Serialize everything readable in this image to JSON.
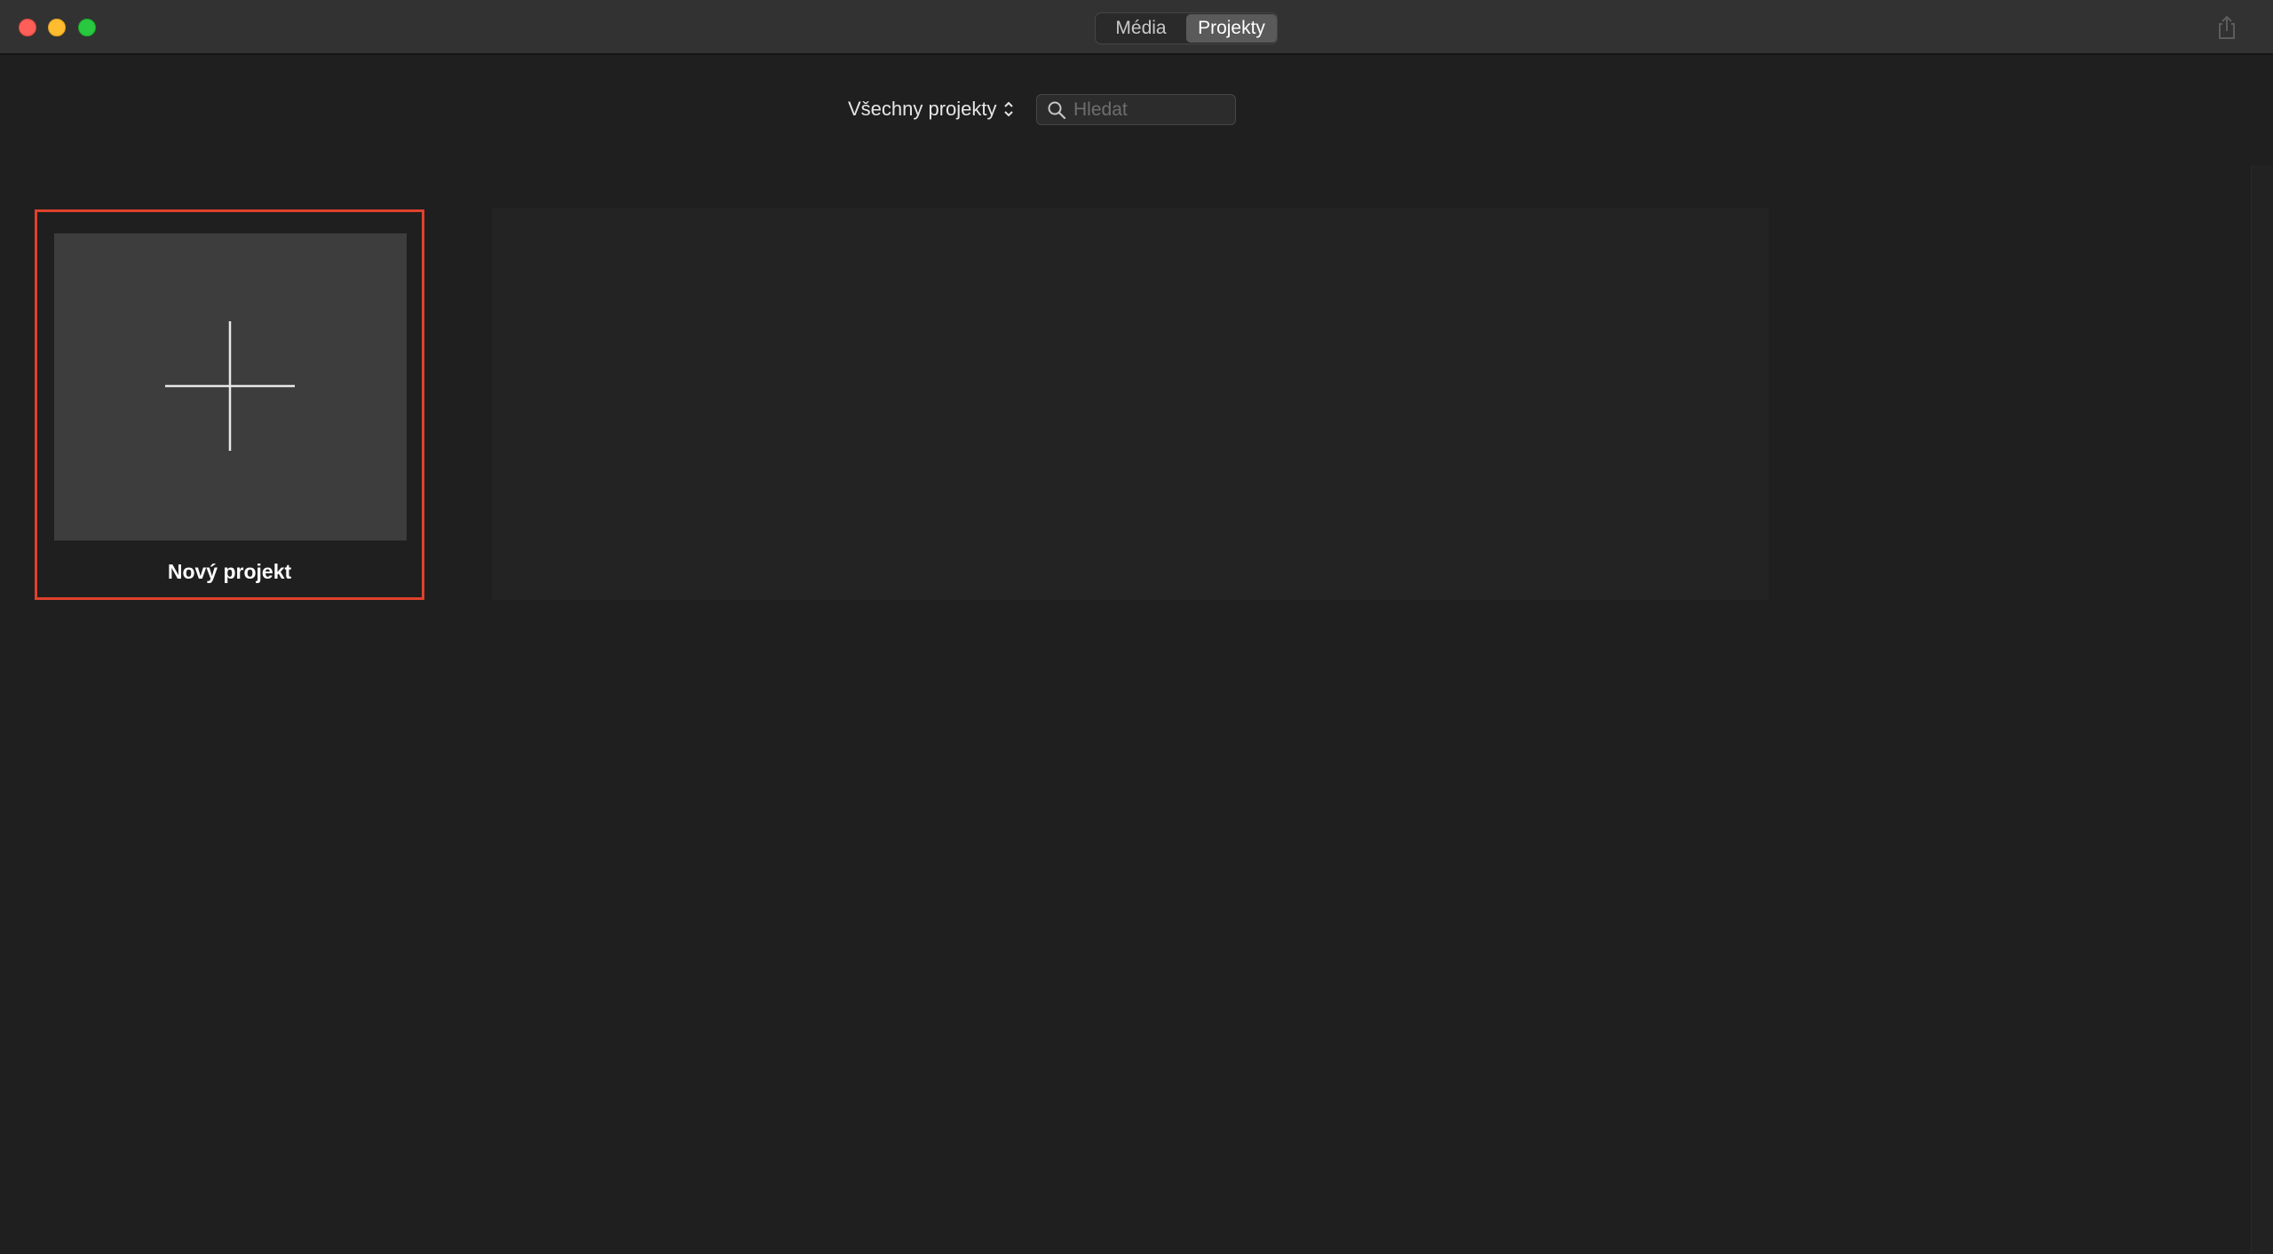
{
  "titlebar": {
    "tabs": [
      {
        "label": "Média",
        "selected": false
      },
      {
        "label": "Projekty",
        "selected": true
      }
    ],
    "share_icon": "share-icon"
  },
  "toolbar": {
    "filter_label": "Všechny projekty",
    "filter_icon": "chevron-updown-icon",
    "search": {
      "placeholder": "Hledat",
      "value": "",
      "icon": "search-icon"
    }
  },
  "projects": {
    "new_project_label": "Nový projekt",
    "new_project_icon": "plus-icon"
  },
  "colors": {
    "selection_outline": "#e0412c",
    "background": "#1f1f1f",
    "titlebar": "#323232"
  }
}
